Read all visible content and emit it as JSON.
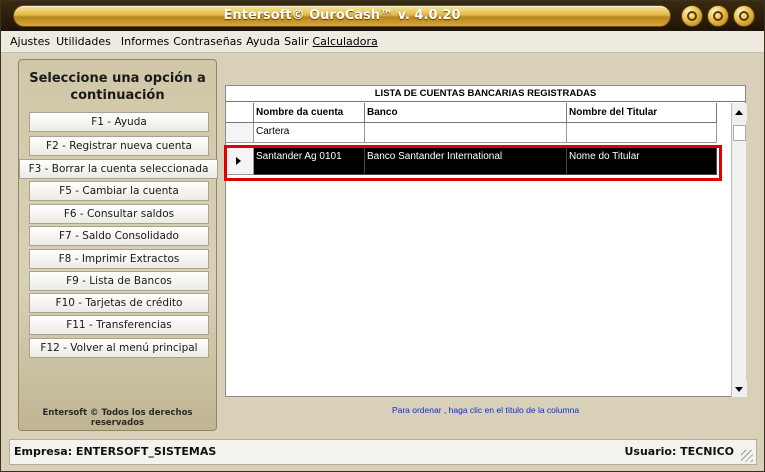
{
  "window": {
    "title": "Entersoft© OuroCash™ v. 4.0.20"
  },
  "menu": {
    "items": [
      "Ajustes",
      "Utilidades",
      "Informes",
      "Contraseñas",
      "Ayuda",
      "Salir",
      "Calculadora"
    ]
  },
  "left_panel": {
    "heading_line1": "Seleccione una opción a",
    "heading_line2": "continuación",
    "buttons": [
      "F1 - Ayuda",
      "F2 - Registrar nueva cuenta",
      "F3 - Borrar la cuenta seleccionada",
      "F5 - Cambiar la cuenta",
      "F6 - Consultar saldos",
      "F7 - Saldo Consolidado",
      "F8 - Imprimir Extractos",
      "F9 - Lista de Bancos",
      "F10 - Tarjetas de crédito",
      "F11 - Transferencias",
      "F12 - Volver al menú principal"
    ],
    "footer": "Entersoft © Todos los derechos reservados"
  },
  "grid": {
    "title": "LISTA DE CUENTAS BANCARIAS REGISTRADAS",
    "columns": [
      "Nombre da cuenta",
      "Banco",
      "Nombre del Titular"
    ],
    "rows": [
      [
        "Cartera",
        "",
        ""
      ],
      [
        "Santander Ag 0101",
        "Banco Santander International",
        "Nome do Titular"
      ]
    ],
    "selected_row": 1,
    "hint": "Para ordenar , haga clic en el título de la columna"
  },
  "status": {
    "company": "Empresa: ENTERSOFT_SISTEMAS",
    "user": "Usuario: TECNICO"
  },
  "colors": {
    "title_gold": "#e2b845",
    "highlight": "#e00000",
    "hint_blue": "#1030c0"
  }
}
